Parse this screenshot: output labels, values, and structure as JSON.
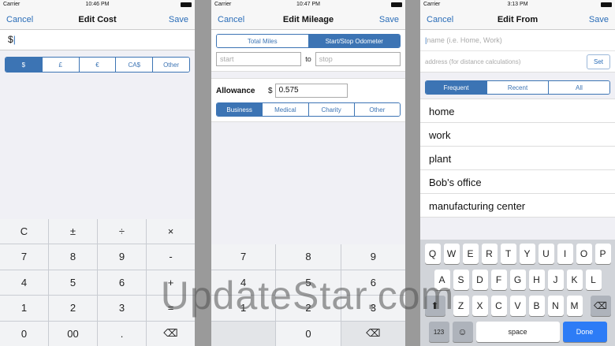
{
  "screen1": {
    "status": {
      "carrier": "Carrier",
      "time": "10:46 PM"
    },
    "nav": {
      "left": "Cancel",
      "title": "Edit Cost",
      "right": "Save"
    },
    "amount_value": "$",
    "currencies": [
      "$",
      "£",
      "€",
      "CA$",
      "Other"
    ],
    "keys": [
      "C",
      "±",
      "÷",
      "×",
      "7",
      "8",
      "9",
      "-",
      "4",
      "5",
      "6",
      "+",
      "1",
      "2",
      "3",
      "=",
      "0",
      "00",
      ".",
      "⌫"
    ]
  },
  "screen2": {
    "status": {
      "carrier": "Carrier",
      "time": "10:47 PM"
    },
    "nav": {
      "left": "Cancel",
      "title": "Edit Mileage",
      "right": "Save"
    },
    "mode_tabs": [
      "Total Miles",
      "Start/Stop Odometer"
    ],
    "start_placeholder": "start",
    "to_label": "to",
    "stop_placeholder": "stop",
    "allowance_label": "Allowance",
    "currency_symbol": "$",
    "allowance_value": "0.575",
    "categories": [
      "Business",
      "Medical",
      "Charity",
      "Other"
    ],
    "keys": [
      "7",
      "8",
      "9",
      "4",
      "5",
      "6",
      "1",
      "2",
      "3",
      "",
      "0",
      "⌫"
    ]
  },
  "screen3": {
    "status": {
      "carrier": "Carrier",
      "time": "3:13 PM"
    },
    "nav": {
      "left": "Cancel",
      "title": "Edit From",
      "right": "Save"
    },
    "name_placeholder": "name (i.e. Home, Work)",
    "address_placeholder": "address (for distance calculations)",
    "set_label": "Set",
    "tabs": [
      "Frequent",
      "Recent",
      "All"
    ],
    "locations": [
      "home",
      "work",
      "plant",
      "Bob's office",
      "manufacturing center"
    ],
    "kb_row1": [
      "Q",
      "W",
      "E",
      "R",
      "T",
      "Y",
      "U",
      "I",
      "O",
      "P"
    ],
    "kb_row2": [
      "A",
      "S",
      "D",
      "F",
      "G",
      "H",
      "J",
      "K",
      "L"
    ],
    "kb_row3": [
      "Z",
      "X",
      "C",
      "V",
      "B",
      "N",
      "M"
    ],
    "kb_123": "123",
    "kb_space": "space",
    "kb_done": "Done"
  },
  "watermark": "UpdateStar.com",
  "colors": {
    "accent": "#3c74b4",
    "nav_link": "#2a6db8",
    "done_key": "#2d7cf6"
  }
}
